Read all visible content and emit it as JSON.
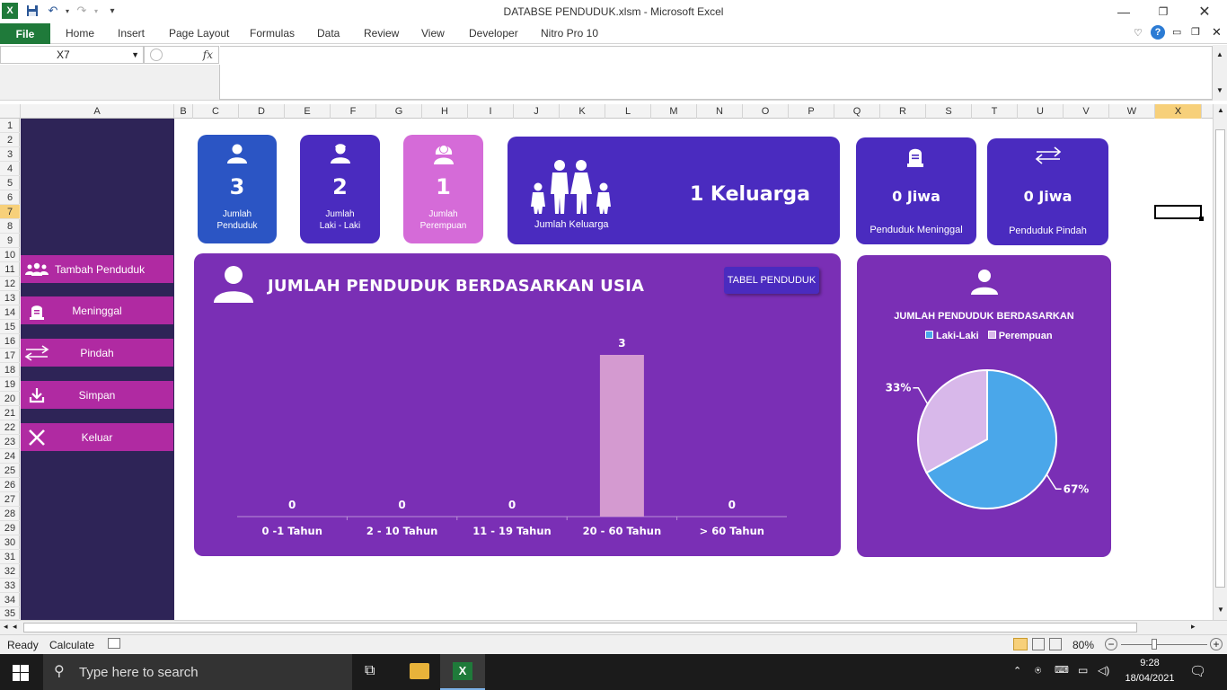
{
  "window": {
    "title": "DATABSE PENDUDUK.xlsm  -  Microsoft Excel"
  },
  "ribbon": {
    "file": "File",
    "tabs": [
      "Home",
      "Insert",
      "Page Layout",
      "Formulas",
      "Data",
      "Review",
      "View",
      "Developer",
      "Nitro Pro 10"
    ]
  },
  "formula_bar": {
    "name_box": "X7",
    "fx": "fx",
    "value": ""
  },
  "grid": {
    "columns": [
      "A",
      "B",
      "C",
      "D",
      "E",
      "F",
      "G",
      "H",
      "I",
      "J",
      "K",
      "L",
      "M",
      "N",
      "O",
      "P",
      "Q",
      "R",
      "S",
      "T",
      "U",
      "V",
      "W",
      "X"
    ],
    "selected_column": "X",
    "rows": [
      "1",
      "2",
      "3",
      "4",
      "5",
      "6",
      "7",
      "8",
      "9",
      "10",
      "11",
      "12",
      "13",
      "14",
      "15",
      "16",
      "17",
      "18",
      "19",
      "20",
      "21",
      "22",
      "23",
      "24",
      "25",
      "26",
      "27",
      "28",
      "29",
      "30",
      "31",
      "32",
      "33",
      "34",
      "35"
    ],
    "selected_row": "7"
  },
  "sidebar": {
    "items": [
      {
        "label": "Tambah Penduduk",
        "icon": "users-icon"
      },
      {
        "label": "Meninggal",
        "icon": "tombstone-icon"
      },
      {
        "label": "Pindah",
        "icon": "transfer-arrows-icon"
      },
      {
        "label": "Simpan",
        "icon": "download-icon"
      },
      {
        "label": "Keluar",
        "icon": "close-icon"
      }
    ]
  },
  "cards": {
    "jumlah_penduduk": {
      "value": "3",
      "label1": "Jumlah",
      "label2": "Penduduk"
    },
    "laki_laki": {
      "value": "2",
      "label1": "Jumlah",
      "label2": "Laki - Laki"
    },
    "perempuan": {
      "value": "1",
      "label1": "Jumlah",
      "label2": "Perempuan"
    },
    "keluarga": {
      "value": "1 Keluarga",
      "label": "Jumlah Keluarga"
    },
    "meninggal": {
      "value": "0 Jiwa",
      "label": "Penduduk Meninggal"
    },
    "pindah": {
      "value": "0 Jiwa",
      "label": "Penduduk Pindah"
    }
  },
  "age_panel": {
    "title": "JUMLAH PENDUDUK BERDASARKAN USIA",
    "button": "TABEL PENDUDUK"
  },
  "gender_panel": {
    "title": "JUMLAH PENDUDUK BERDASARKAN"
  },
  "colors": {
    "card_blue": "#2b55c4",
    "card_indigo": "#4a2bbf",
    "card_pink": "#d56bd8",
    "panel_purple": "#7a2fb5",
    "sidebar_bg": "#2e2457",
    "sidebar_btn": "#b02aa2",
    "bar": "#d49ad0",
    "pie_laki": "#4aa7ea",
    "pie_perempuan": "#d8b8ea"
  },
  "chart_data": [
    {
      "type": "bar",
      "categories": [
        "0 -1 Tahun",
        "2 - 10 Tahun",
        "11 - 19 Tahun",
        "20 - 60 Tahun",
        "> 60 Tahun"
      ],
      "values": [
        0,
        0,
        0,
        3,
        0
      ],
      "title": "JUMLAH PENDUDUK BERDASARKAN USIA",
      "ylim": [
        0,
        3.5
      ],
      "grid": false
    },
    {
      "type": "pie",
      "categories": [
        "Laki-Laki",
        "Perempuan"
      ],
      "values": [
        67,
        33
      ],
      "labels": [
        "67%",
        "33%"
      ],
      "title": "JUMLAH PENDUDUK BERDASARKAN",
      "legend": "top"
    }
  ],
  "status": {
    "ready": "Ready",
    "calculate": "Calculate",
    "zoom": "80%"
  },
  "taskbar": {
    "search_placeholder": "Type here to search",
    "time": "9:28",
    "date": "18/04/2021"
  }
}
